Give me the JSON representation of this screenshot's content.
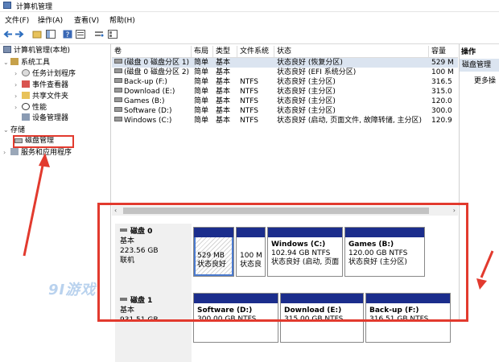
{
  "window": {
    "title": "计算机管理"
  },
  "menu": [
    "文件(F)",
    "操作(A)",
    "查看(V)",
    "帮助(H)"
  ],
  "tree": {
    "root": "计算机管理(本地)",
    "system_tools": "系统工具",
    "task_scheduler": "任务计划程序",
    "event_viewer": "事件查看器",
    "shared_folders": "共享文件夹",
    "performance": "性能",
    "device_manager": "设备管理器",
    "storage": "存储",
    "disk_management": "磁盘管理",
    "services": "服务和应用程序"
  },
  "columns": [
    "卷",
    "布局",
    "类型",
    "文件系统",
    "状态",
    "容量"
  ],
  "volumes": [
    {
      "name": "(磁盘 0 磁盘分区 1)",
      "layout": "简单",
      "type": "基本",
      "fs": "",
      "status": "状态良好 (恢复分区)",
      "capacity": "529 M"
    },
    {
      "name": "(磁盘 0 磁盘分区 2)",
      "layout": "简单",
      "type": "基本",
      "fs": "",
      "status": "状态良好 (EFI 系统分区)",
      "capacity": "100 M"
    },
    {
      "name": "Back-up (F:)",
      "layout": "简单",
      "type": "基本",
      "fs": "NTFS",
      "status": "状态良好 (主分区)",
      "capacity": "316.5"
    },
    {
      "name": "Download (E:)",
      "layout": "简单",
      "type": "基本",
      "fs": "NTFS",
      "status": "状态良好 (主分区)",
      "capacity": "315.0"
    },
    {
      "name": "Games (B:)",
      "layout": "简单",
      "type": "基本",
      "fs": "NTFS",
      "status": "状态良好 (主分区)",
      "capacity": "120.0"
    },
    {
      "name": "Software (D:)",
      "layout": "简单",
      "type": "基本",
      "fs": "NTFS",
      "status": "状态良好 (主分区)",
      "capacity": "300.0"
    },
    {
      "name": "Windows (C:)",
      "layout": "简单",
      "type": "基本",
      "fs": "NTFS",
      "status": "状态良好 (启动, 页面文件, 故障转储, 主分区)",
      "capacity": "120.9"
    }
  ],
  "actions": {
    "header": "操作",
    "section": "磁盘管理",
    "more": "更多操"
  },
  "disk0": {
    "title": "磁盘 0",
    "kind": "基本",
    "size": "223.56 GB",
    "state": "联机",
    "parts": [
      {
        "name": "",
        "size": "529 MB",
        "status": "状态良好"
      },
      {
        "name": "",
        "size": "100 M",
        "status": "状态良"
      },
      {
        "name": "Windows  (C:)",
        "size": "102.94 GB NTFS",
        "status": "状态良好 (启动, 页面"
      },
      {
        "name": "Games  (B:)",
        "size": "120.00 GB NTFS",
        "status": "状态良好 (主分区)"
      }
    ]
  },
  "disk1": {
    "title": "磁盘 1",
    "kind": "基本",
    "size": "931.51 GB",
    "state": "",
    "parts": [
      {
        "name": "Software  (D:)",
        "size": "300.00 GB NTFS"
      },
      {
        "name": "Download  (E:)",
        "size": "315.00 GB NTFS"
      },
      {
        "name": "Back-up  (F:)",
        "size": "316.51 GB NTFS"
      }
    ]
  },
  "watermark": "9I游戏",
  "colors": {
    "partition_bar": "#1b2d8c",
    "annotation": "#e23a2e",
    "selection": "#dbe4f0"
  }
}
